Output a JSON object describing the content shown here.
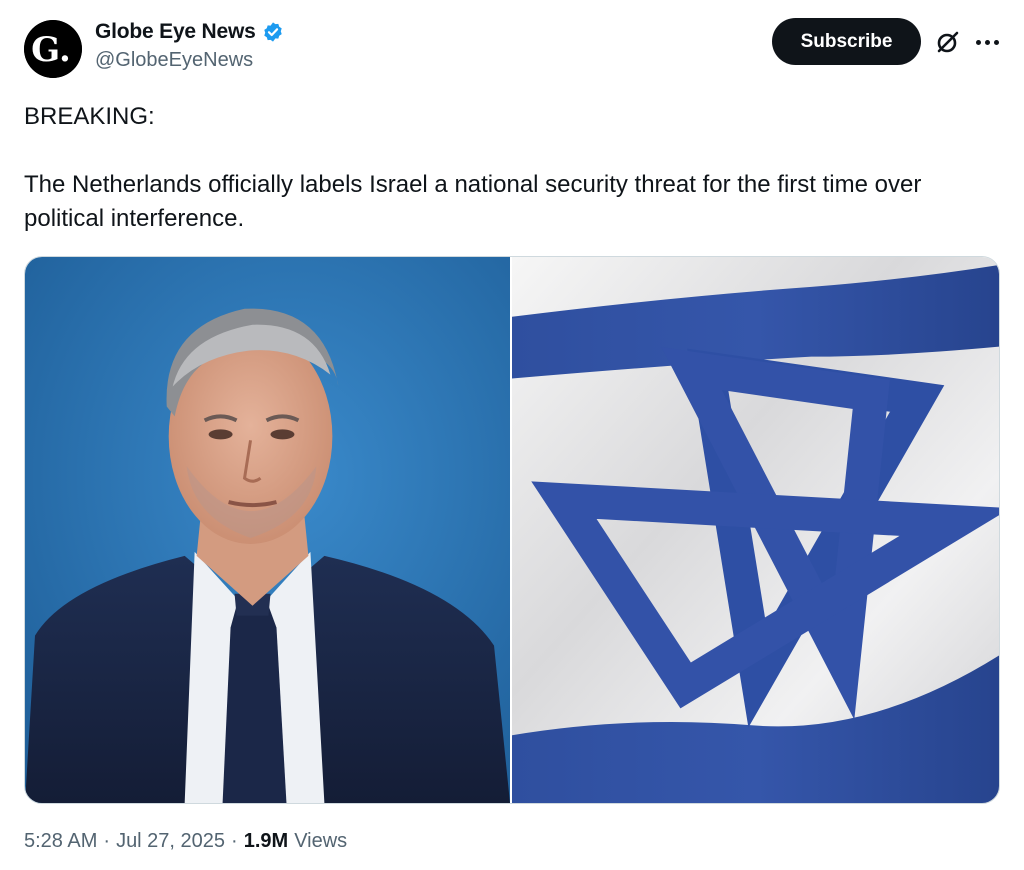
{
  "author": {
    "display_name": "Globe Eye News",
    "handle": "@GlobeEyeNews",
    "avatar_letter": "G.",
    "verified": true
  },
  "actions": {
    "subscribe_label": "Subscribe",
    "grok_icon": "grok-icon",
    "more_icon": "more-icon"
  },
  "tweet": {
    "line1": "BREAKING:",
    "line2": "The Netherlands officially labels Israel a national security threat for the first time over political interference."
  },
  "media": [
    {
      "description_icon": "portrait-photo"
    },
    {
      "description_icon": "israel-flag-photo"
    }
  ],
  "footer": {
    "time": "5:28 AM",
    "date": "Jul 27, 2025",
    "views_count": "1.9M",
    "views_label": "Views"
  },
  "colors": {
    "verified_blue": "#1d9bf0",
    "flag_blue": "#2e4fa4",
    "portrait_bg": "#2f7cbc"
  }
}
